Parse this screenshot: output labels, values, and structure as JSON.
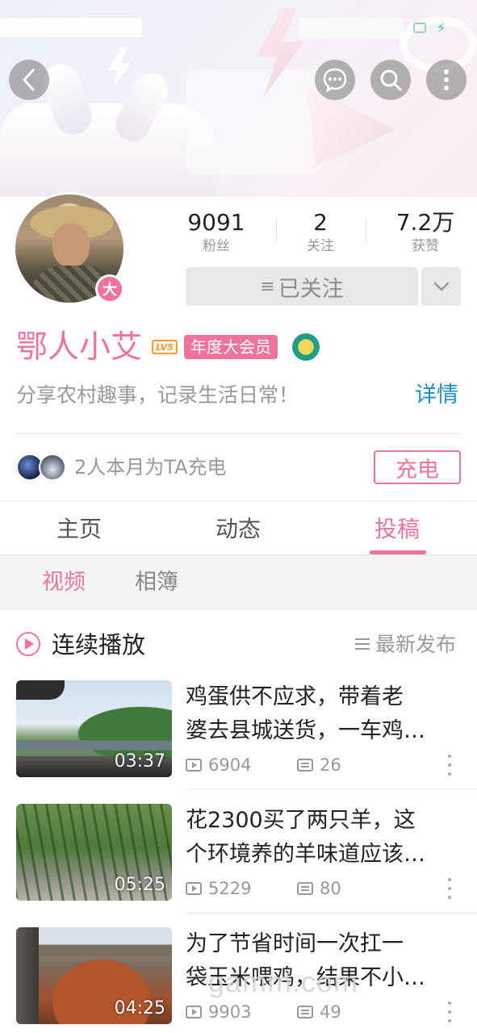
{
  "header": {
    "back_icon": "chevron-left-icon",
    "message_icon": "chat-bubble-icon",
    "search_icon": "search-icon",
    "more_icon": "more-vertical-icon"
  },
  "profile": {
    "stats": [
      {
        "value": "9091",
        "label": "粉丝"
      },
      {
        "value": "2",
        "label": "关注"
      },
      {
        "value": "7.2万",
        "label": "获赞"
      }
    ],
    "follow_button": "已关注",
    "avatar_badge": "大",
    "name": "鄂人小艾",
    "level_badge": "LV5",
    "vip_badge": "年度大会员",
    "bio": "分享农村趣事，记录生活日常！",
    "detail_link": "详情",
    "charge_text": "2人本月为TA充电",
    "charge_button": "充电"
  },
  "tabs": [
    {
      "label": "主页",
      "active": false
    },
    {
      "label": "动态",
      "active": false
    },
    {
      "label": "投稿",
      "active": true
    }
  ],
  "subtabs": [
    {
      "label": "视频",
      "active": true
    },
    {
      "label": "相簿",
      "active": false
    }
  ],
  "list_header": {
    "play_all": "连续播放",
    "sort": "最新发布"
  },
  "videos": [
    {
      "title_line1": "鸡蛋供不应求，带着老",
      "title_line2": "婆去县城送货，一车鸡…",
      "duration": "03:37",
      "plays": "6904",
      "danmaku": "26"
    },
    {
      "title_line1": "花2300买了两只羊，这",
      "title_line2": "个环境养的羊味道应该…",
      "duration": "05:25",
      "plays": "5229",
      "danmaku": "80"
    },
    {
      "title_line1": "为了节省时间一次扛一",
      "title_line2": "袋玉米喂鸡，结果不小…",
      "duration": "04:25",
      "plays": "9903",
      "danmaku": "49"
    }
  ],
  "colors": {
    "accent_pink": "#f0739b",
    "link_blue": "#1d92c9",
    "level_orange": "#f29b38"
  },
  "watermark": "gamm.com"
}
